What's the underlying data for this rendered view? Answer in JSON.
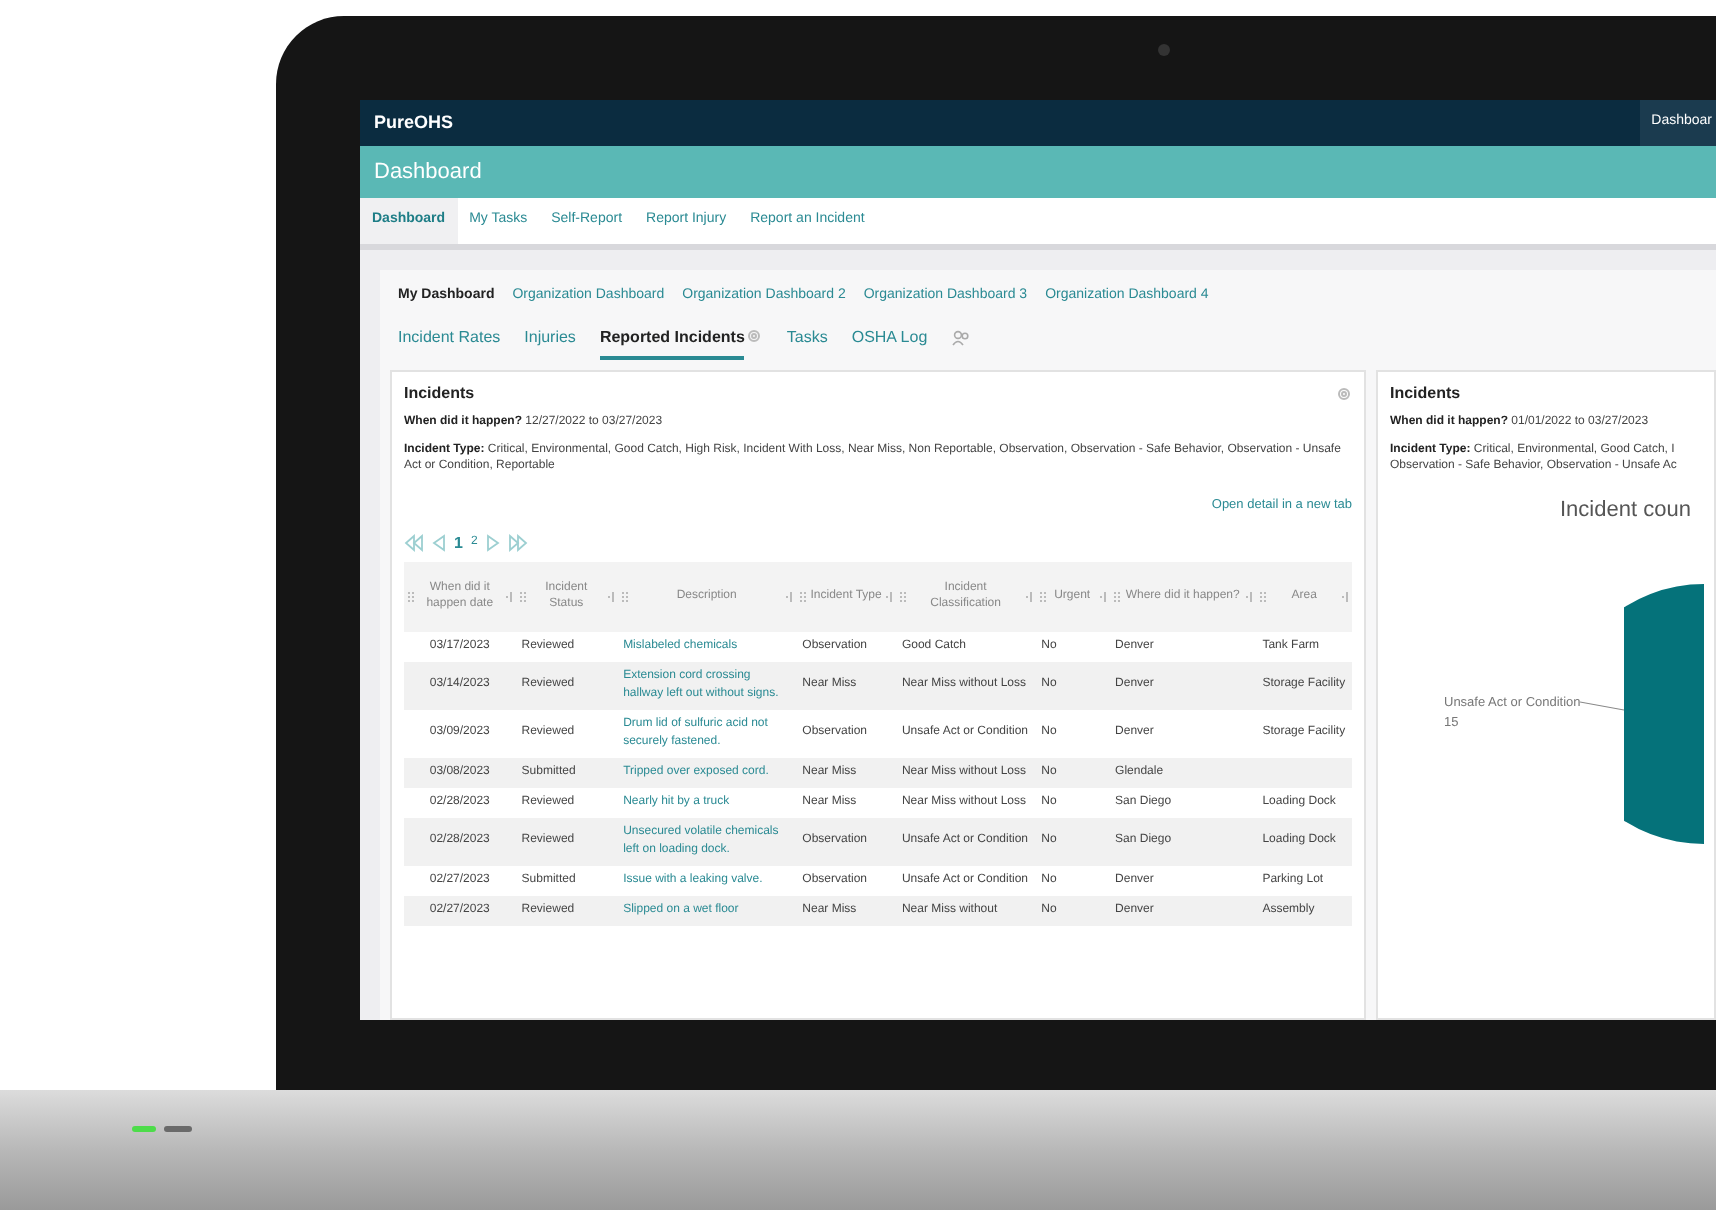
{
  "brand": {
    "logo": "PureOHS",
    "top_right": "Dashboar"
  },
  "page_title": "Dashboard",
  "nav": [
    {
      "label": "Dashboard",
      "selected": true
    },
    {
      "label": "My Tasks",
      "selected": false
    },
    {
      "label": "Self-Report",
      "selected": false
    },
    {
      "label": "Report Injury",
      "selected": false
    },
    {
      "label": "Report an Incident",
      "selected": false
    }
  ],
  "dashboards": [
    {
      "label": "My Dashboard",
      "selected": true
    },
    {
      "label": "Organization Dashboard",
      "selected": false
    },
    {
      "label": "Organization Dashboard 2",
      "selected": false
    },
    {
      "label": "Organization Dashboard 3",
      "selected": false
    },
    {
      "label": "Organization Dashboard 4",
      "selected": false
    }
  ],
  "tabs": [
    {
      "label": "Incident Rates",
      "selected": false
    },
    {
      "label": "Injuries",
      "selected": false
    },
    {
      "label": "Reported Incidents",
      "selected": true
    },
    {
      "label": "Tasks",
      "selected": false
    },
    {
      "label": "OSHA Log",
      "selected": false
    }
  ],
  "left_card": {
    "title": "Incidents",
    "when_label": "When did it happen?",
    "when_value": "12/27/2022 to 03/27/2023",
    "type_label": "Incident Type:",
    "type_value": "Critical, Environmental, Good Catch, High Risk, Incident With Loss, Near Miss, Non Reportable, Observation, Observation - Safe Behavior, Observation - Unsafe Act or Condition, Reportable",
    "open_link": "Open detail in a new tab",
    "pages": [
      {
        "label": "1",
        "selected": true
      },
      {
        "label": "2",
        "selected": false
      }
    ],
    "table": {
      "columns": [
        "When did it happen date",
        "Incident Status",
        "Description",
        "Incident Type",
        "Incident Classification",
        "Urgent",
        "Where did it happen?",
        "Area"
      ],
      "rows": [
        [
          "03/17/2023",
          "Reviewed",
          "Mislabeled chemicals",
          "Observation",
          "Good Catch",
          "No",
          "Denver",
          "Tank Farm"
        ],
        [
          "03/14/2023",
          "Reviewed",
          "Extension cord crossing hallway left out without signs.",
          "Near Miss",
          "Near Miss without Loss",
          "No",
          "Denver",
          "Storage Facility"
        ],
        [
          "03/09/2023",
          "Reviewed",
          "Drum lid of sulfuric acid not securely fastened.",
          "Observation",
          "Unsafe Act or Condition",
          "No",
          "Denver",
          "Storage Facility"
        ],
        [
          "03/08/2023",
          "Submitted",
          "Tripped over exposed cord.",
          "Near Miss",
          "Near Miss without Loss",
          "No",
          "Glendale",
          ""
        ],
        [
          "02/28/2023",
          "Reviewed",
          "Nearly hit by a truck",
          "Near Miss",
          "Near Miss without Loss",
          "No",
          "San Diego",
          "Loading Dock"
        ],
        [
          "02/28/2023",
          "Reviewed",
          "Unsecured volatile chemicals left on loading dock.",
          "Observation",
          "Unsafe Act or Condition",
          "No",
          "San Diego",
          "Loading Dock"
        ],
        [
          "02/27/2023",
          "Submitted",
          "Issue with a leaking valve.",
          "Observation",
          "Unsafe Act or Condition",
          "No",
          "Denver",
          "Parking Lot"
        ],
        [
          "02/27/2023",
          "Reviewed",
          "Slipped on a wet floor",
          "Near Miss",
          "Near Miss without",
          "No",
          "Denver",
          "Assembly"
        ]
      ]
    }
  },
  "right_card": {
    "title": "Incidents",
    "when_label": "When did it happen?",
    "when_value": "01/01/2022 to 03/27/2023",
    "type_label": "Incident Type:",
    "type_value": "Critical, Environmental, Good Catch, I",
    "type_value_2": "Observation - Safe Behavior, Observation - Unsafe Ac",
    "chart_title": "Incident coun",
    "slice_label": "Unsafe Act or Condition",
    "slice_value": "15"
  }
}
